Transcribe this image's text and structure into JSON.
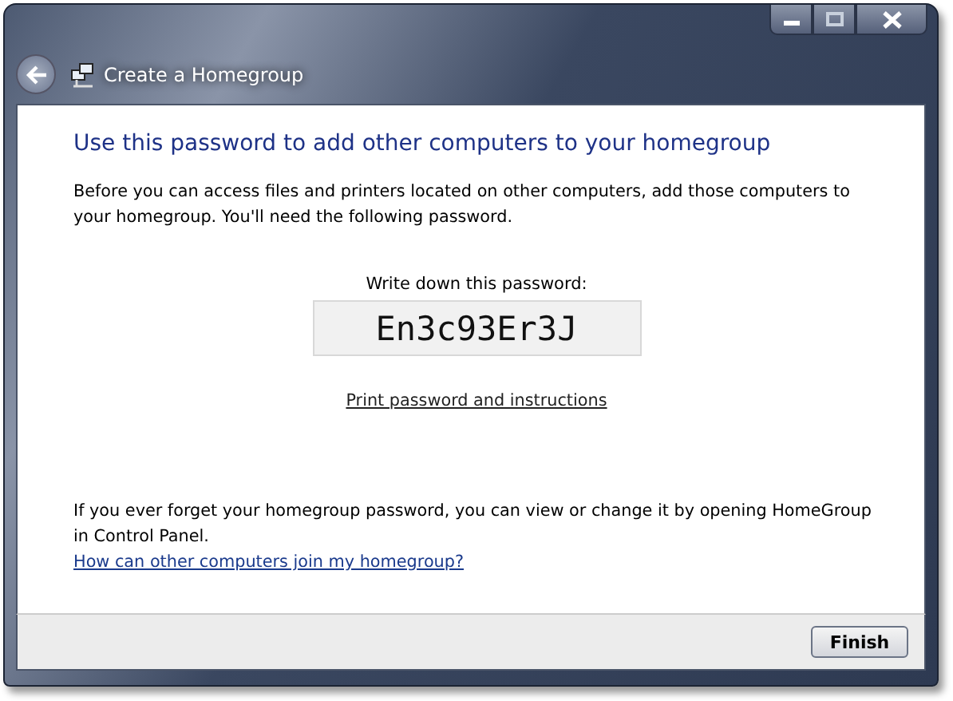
{
  "window": {
    "title": "Create a Homegroup"
  },
  "heading": "Use this password to add other computers to your homegroup",
  "intro": "Before you can access files and printers located on other computers, add those computers to your homegroup. You'll need the following password.",
  "password_label": "Write down this password:",
  "password": "En3c93Er3J",
  "print_link": "Print password and instructions",
  "forget_note": "If you ever forget your homegroup password, you can view or change it by opening HomeGroup in Control Panel.",
  "help_link": "How can other computers join my homegroup?",
  "buttons": [
    "Finish"
  ]
}
